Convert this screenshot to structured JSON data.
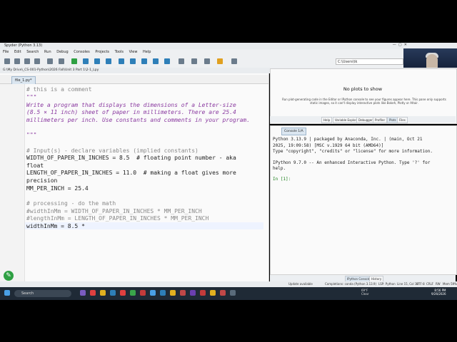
{
  "window": {
    "title": "Spyder (Python 3.13)"
  },
  "menu": [
    "File",
    "Edit",
    "Search",
    "Run",
    "Debug",
    "Consoles",
    "Projects",
    "Tools",
    "View",
    "Help"
  ],
  "path_box": "C:\\Users\\tk",
  "file_path": "G:\\My Drive\\_CS-001-Python\\2026 Fall\\Unit 3 Part 1\\2-1_Lpy",
  "editor": {
    "tab_label": "file_1.py*",
    "lines": [
      {
        "n": "1",
        "text": "# this is a comment"
      },
      {
        "n": "2",
        "text": "\"\"\""
      },
      {
        "n": "3",
        "text": "Write a program that displays the dimensions of a Letter-size"
      },
      {
        "n": "",
        "text": "(8.5 × 11 inch) sheet of paper in millimeters. There are 25.4"
      },
      {
        "n": "",
        "text": "millimeters per inch. Use constants and comments in your program."
      },
      {
        "n": "4",
        "text": ""
      },
      {
        "n": "5",
        "text": "\"\"\""
      },
      {
        "n": "6",
        "text": ""
      },
      {
        "n": "7",
        "text": "# Input(s) - declare variables (implied constants)"
      },
      {
        "n": "8",
        "text": "WIDTH_OF_PAPER_IN_INCHES = 8.5  # floating point number - aka"
      },
      {
        "n": "",
        "text": "float"
      },
      {
        "n": "9",
        "text": "LENGTH_OF_PAPER_IN_INCHES = 11.0  # making a float gives more"
      },
      {
        "n": "",
        "text": "precision"
      },
      {
        "n": "10",
        "text": "MM_PER_INCH = 25.4"
      },
      {
        "n": "11",
        "text": ""
      },
      {
        "n": "12",
        "text": "# processing - do the math"
      },
      {
        "n": "13",
        "text": "#widthInMm = WIDTH_OF_PAPER_IN_INCHES * MM_PER_INCH"
      },
      {
        "n": "14",
        "text": "#lengthInMm = LENGTH_OF_PAPER_IN_INCHES * MM_PER_INCH"
      },
      {
        "n": "15",
        "text": "widthInMm = 8.5 *"
      }
    ]
  },
  "plots": {
    "title": "No plots to show",
    "message": "Run plot-generating code in the Editor or IPython console to see your figures appear here. This pane only supports static images, so it can't display interactive plots like Bokeh, Plotly or Altair.",
    "tabs": [
      "Help",
      "Variable Explorer",
      "Debugger",
      "Profiler",
      "Plots",
      "Files"
    ],
    "active_tab": "Plots"
  },
  "console": {
    "tab_label": "Console 1/A",
    "lines": [
      "Python 3.13.9 | packaged by Anaconda, Inc. | (main, Oct 21",
      "2025, 19:09:58) [MSC v.1929 64 bit (AMD64)]",
      "Type \"copyright\", \"credits\" or \"license\" for more information.",
      "",
      "IPython 9.7.0 -- An enhanced Interactive Python. Type '?' for",
      "help.",
      ""
    ],
    "prompt": "In [1]:",
    "tabs": [
      "IPython Console",
      "History"
    ]
  },
  "status": {
    "update": "Update available",
    "completions": "Completions: conda (Python 3.13.9)",
    "lsp": "LSP: Python",
    "position": "Line 15, Col 18",
    "encoding": "UTF-8",
    "eol": "CRLF",
    "rw": "RW",
    "mem": "Mem 59%"
  },
  "taskbar": {
    "search_placeholder": "Search",
    "weather_temp": "69°F",
    "weather_desc": "Clear",
    "time": "8:56 PM",
    "date": "9/26/2026"
  },
  "colors": {
    "accent": "#2ea043",
    "doc": "#8a3aa0",
    "comment": "#8a8a8a"
  }
}
